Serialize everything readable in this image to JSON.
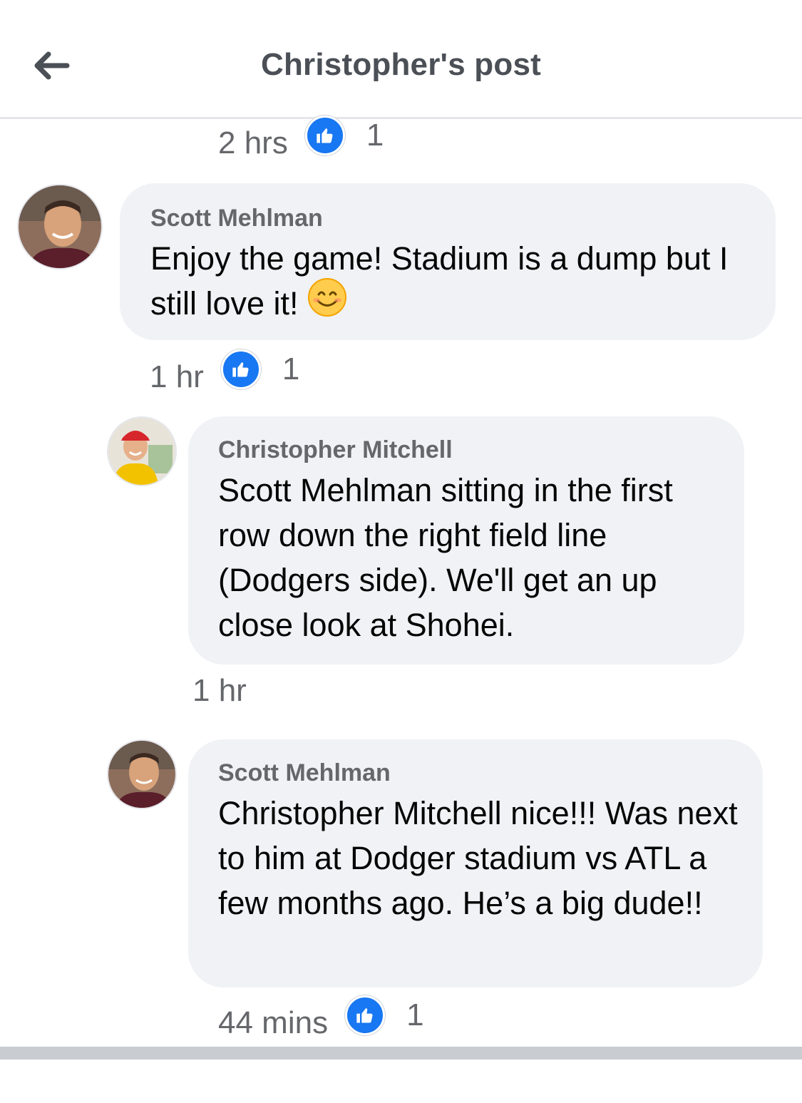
{
  "header": {
    "title": "Christopher's post",
    "back_icon": "arrow-left-icon"
  },
  "top_meta": {
    "time": "2 hrs",
    "like_count": "1"
  },
  "comments": [
    {
      "author": "Scott Mehlman",
      "text": "Enjoy the game! Stadium is a dump but I still love it!",
      "emoji": "smiling-face-icon",
      "time": "1 hr",
      "like_count": "1"
    },
    {
      "author": "Christopher Mitchell",
      "text": "Scott Mehlman sitting in the first row down the right field line (Dodgers side). We'll get an up close look at Shohei.",
      "time": "1 hr",
      "like_count": ""
    },
    {
      "author": "Scott Mehlman",
      "text": "Christopher Mitchell nice!!! Was next to him at Dodger stadium vs ATL a few months ago. He’s a big dude!!",
      "time": "44 mins",
      "like_count": "1"
    }
  ],
  "colors": {
    "like_blue": "#1877f2",
    "bubble_bg": "#f0f2f5",
    "meta_gray": "#65676b"
  }
}
